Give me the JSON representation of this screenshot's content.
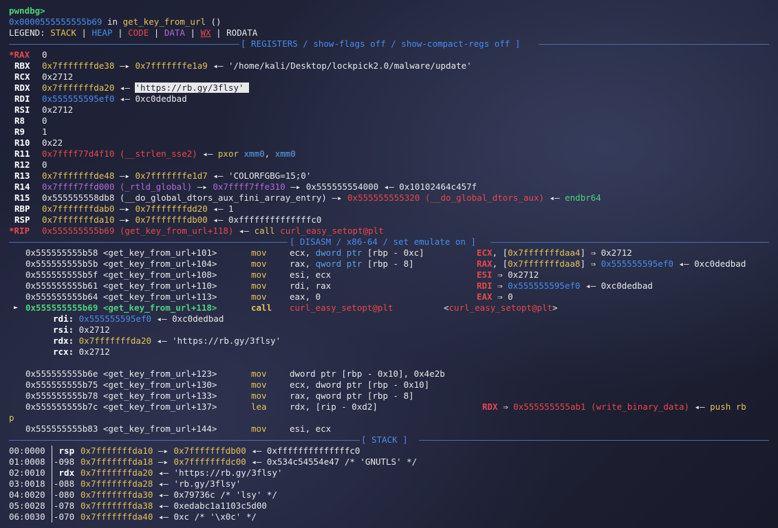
{
  "prompt": "pwndbg>",
  "location": {
    "addr": "0x0000555555555b69",
    "in": " in ",
    "func": "get_key_from_url",
    "args": " ()"
  },
  "legend": {
    "label": "LEGEND: ",
    "stack": "STACK",
    "heap": "HEAP",
    "code": "CODE",
    "data": "DATA",
    "wx": "WX",
    "rodata": "RODATA",
    "sep": " | "
  },
  "registers_header": "[ REGISTERS / show-flags off / show-compact-regs off ]",
  "registers": {
    "rax": {
      "name": "*RAX",
      "val": "0"
    },
    "rbx": {
      "name": "RBX",
      "val": "0x7fffffffde38",
      "a1": " —▸ ",
      "v2": "0x7fffffffe1a9",
      "a2": " ◂— ",
      "v3": "'/home/kali/Desktop/lockpick2.0/malware/update'"
    },
    "rcx": {
      "name": "RCX",
      "val": "0x2712"
    },
    "rdx": {
      "name": "RDX",
      "val": "0x7fffffffda20",
      "a1": " ◂— ",
      "v2": "'https://rb.gy/3flsy'"
    },
    "rdi": {
      "name": "RDI",
      "val": "0x555555595ef0",
      "a1": " ◂— ",
      "v2": "0xc0dedbad"
    },
    "rsi": {
      "name": "RSI",
      "val": "0x2712"
    },
    "r8": {
      "name": "R8",
      "val": "0"
    },
    "r9": {
      "name": "R9",
      "val": "1"
    },
    "r10": {
      "name": "R10",
      "val": "0x22"
    },
    "r11": {
      "name": "R11",
      "val": "0x7ffff77d4f10 (__strlen_sse2)",
      "a1": " ◂— ",
      "ins": "pxor",
      "op1": "xmm0",
      "comma": ", ",
      "op2": "xmm0"
    },
    "r12": {
      "name": "R12",
      "val": "0"
    },
    "r13": {
      "name": "R13",
      "val": "0x7fffffffde48",
      "a1": " —▸ ",
      "v2": "0x7fffffffe1d7",
      "a2": " ◂— ",
      "v3": "'COLORFGBG=15;0'"
    },
    "r14": {
      "name": "R14",
      "val": "0x7ffff7ffd000 (_rtld_global)",
      "a1": " —▸ ",
      "v2": "0x7ffff7ffe310",
      "a2": " —▸ ",
      "v3": "0x555555554000",
      "a3": " ◂— ",
      "v4": "0x10102464c457f"
    },
    "r15": {
      "name": "R15",
      "val": "0x555555558db8 (__do_global_dtors_aux_fini_array_entry)",
      "a1": " —▸ ",
      "v2": "0x555555555320 (__do_global_dtors_aux)",
      "a2": " ◂— ",
      "v3": "endbr64"
    },
    "rbp": {
      "name": "RBP",
      "val": "0x7fffffffdab0",
      "a1": " —▸ ",
      "v2": "0x7fffffffdd20",
      "a2": " ◂— ",
      "v3": "1"
    },
    "rsp": {
      "name": "RSP",
      "val": "0x7fffffffda10",
      "a1": " —▸ ",
      "v2": "0x7fffffffdb00",
      "a2": " ◂— ",
      "v3": "0xffffffffffffffc0"
    },
    "rip": {
      "name": "*RIP",
      "val": "0x555555555b69 (get_key_from_url+118)",
      "a1": " ◂— ",
      "ins": "call",
      "tgt": "curl_easy_setopt@plt"
    }
  },
  "disasm_header": "[ DISASM / x86-64 / set emulate on ]",
  "disasm": [
    {
      "addr": "0x555555555b58 <get_key_from_url+101>",
      "mn": "mov",
      "p1": "ecx, ",
      "p2": "dword ptr",
      "p3": " [rbp - 0xc]",
      "eq": "ECX",
      "eq2": ", [",
      "eq3": "0x7fffffffdaa4",
      "eq4": "] ⇒ 0x2712"
    },
    {
      "addr": "0x555555555b5b <get_key_from_url+104>",
      "mn": "mov",
      "p1": "rax, ",
      "p2": "qword ptr",
      "p3": " [rbp - 8]",
      "eq": "RAX",
      "eq2": ", [",
      "eq3": "0x7fffffffdaa8",
      "eq4": "] ⇒ ",
      "eq5": "0x555555595ef0",
      "eq6": " ◂— 0xc0dedbad"
    },
    {
      "addr": "0x555555555b5f <get_key_from_url+108>",
      "mn": "mov",
      "p1": "esi, ecx",
      "eq": "ESI",
      "eq2": " ⇒ 0x2712"
    },
    {
      "addr": "0x555555555b61 <get_key_from_url+110>",
      "mn": "mov",
      "p1": "rdi, rax",
      "eq": "RDI",
      "eq2": " ⇒ ",
      "eq3": "0x555555595ef0",
      "eq4": " ◂— 0xc0dedbad"
    },
    {
      "addr": "0x555555555b64 <get_key_from_url+113>",
      "mn": "mov",
      "p1": "eax, 0",
      "eq": "EAX",
      "eq2": " ⇒ 0"
    }
  ],
  "current": {
    "marker": "►",
    "addr": "0x555555555b69 <get_key_from_url+118>",
    "mn": "call",
    "tgt": "curl_easy_setopt@plt",
    "tgt2": "<curl_easy_setopt@plt>"
  },
  "call_args": [
    {
      "n": "rdi:",
      "v": "0x555555595ef0",
      "a": " ◂— 0xc0dedbad"
    },
    {
      "n": "rsi:",
      "v": "0x2712"
    },
    {
      "n": "rdx:",
      "v": "0x7fffffffda20",
      "a": " ◂— 'https://rb.gy/3flsy'"
    },
    {
      "n": "rcx:",
      "v": "0x2712"
    }
  ],
  "disasm2": [
    {
      "addr": "0x555555555b6e <get_key_from_url+123>",
      "mn": "mov",
      "p": "dword ptr [rbp - 0x10], 0x4e2b"
    },
    {
      "addr": "0x555555555b75 <get_key_from_url+130>",
      "mn": "mov",
      "p": "ecx, dword ptr [rbp - 0x10]"
    },
    {
      "addr": "0x555555555b78 <get_key_from_url+133>",
      "mn": "mov",
      "p": "rax, qword ptr [rbp - 8]"
    },
    {
      "addr": "0x555555555b7c <get_key_from_url+137>",
      "mn": "lea",
      "p": "rdx, [rip - 0xd2]",
      "eq": "RDX",
      "eq2": " ⇒ ",
      "eq3": "0x555555555ab1 (write_binary_data)",
      "eq4": " ◂— ",
      "eq5": "push rb",
      "wrap": "p"
    },
    {
      "addr": "0x555555555b83 <get_key_from_url+144>",
      "mn": "mov",
      "p": "esi, ecx"
    }
  ],
  "stack_header": "[ STACK ]",
  "stack": [
    {
      "idx": "00:0000",
      "off": " rsp ",
      "addr": "0x7fffffffda10",
      "a1": " —▸ ",
      "v2": "0x7fffffffdb00",
      "rest": " ◂— 0xffffffffffffffc0"
    },
    {
      "idx": "01:0008",
      "off": "-098 ",
      "addr": "0x7fffffffda18",
      "a1": " —▸ ",
      "v2": "0x7fffffffdc00",
      "rest": " ◂— 0x534c54554e47 /* 'GNUTLS' */"
    },
    {
      "idx": "02:0010",
      "off": " rdx ",
      "addr": "0x7fffffffda20",
      "rest": " ◂— 'https://rb.gy/3flsy'"
    },
    {
      "idx": "03:0018",
      "off": "-088 ",
      "addr": "0x7fffffffda28",
      "rest": " ◂— 'rb.gy/3flsy'"
    },
    {
      "idx": "04:0020",
      "off": "-080 ",
      "addr": "0x7fffffffda30",
      "rest": " ◂— 0x79736c /* 'lsy' */"
    },
    {
      "idx": "05:0028",
      "off": "-078 ",
      "addr": "0x7fffffffda38",
      "rest": " ◂— 0xedabc1a1103c5d00"
    },
    {
      "idx": "06:0030",
      "off": "-070 ",
      "addr": "0x7fffffffda40",
      "rest": " ◂— 0xc /* '\\x0c' */"
    }
  ]
}
